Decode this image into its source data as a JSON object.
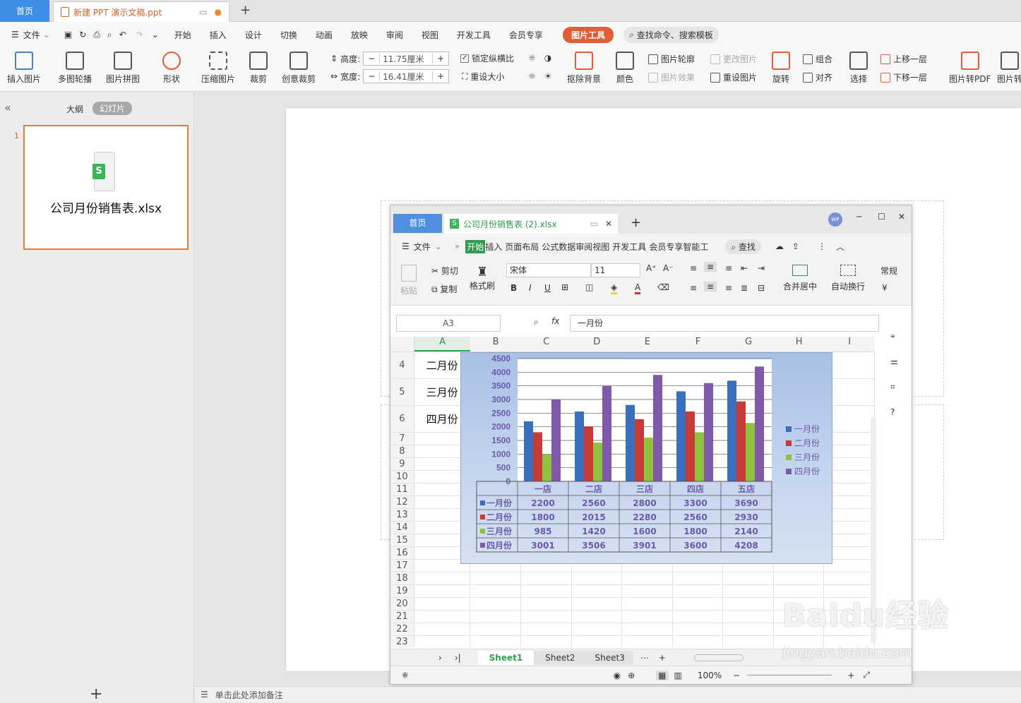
{
  "title_tabs": {
    "home": "首页",
    "doc": "新建 PPT 演示文稿.ppt",
    "new_tab": "+"
  },
  "menu": {
    "file": "文件",
    "items": [
      "开始",
      "插入",
      "设计",
      "切换",
      "动画",
      "放映",
      "审阅",
      "视图",
      "开发工具",
      "会员专享"
    ],
    "active": "图片工具",
    "search": "查找命令、搜索模板"
  },
  "ribbon": {
    "insert_picture": "插入图片",
    "multi_carousel": "多图轮播",
    "picture_collage": "图片拼图",
    "shape": "形状",
    "compress": "压缩图片",
    "crop": "裁剪",
    "creative_crop": "创意裁剪",
    "height_label": "高度:",
    "height_value": "11.75厘米",
    "width_label": "宽度:",
    "width_value": "16.41厘米",
    "lock_ratio": "锁定纵横比",
    "reset_size": "重设大小",
    "remove_bg": "抠除背景",
    "color": "颜色",
    "outline": "图片轮廓",
    "effect": "图片效果",
    "change_pic": "更改图片",
    "reset_pic": "重设图片",
    "rotate": "旋转",
    "group": "组合",
    "align": "对齐",
    "select": "选择",
    "bring_forward": "上移一层",
    "send_backward": "下移一层",
    "to_pdf": "图片转PDF",
    "to_text": "图片转"
  },
  "left_panel": {
    "tab_outline": "大纲",
    "tab_slides": "幻灯片",
    "slide_number": "1",
    "slide_caption": "公司月份销售表.xlsx",
    "add": "+"
  },
  "notes": "单击此处添加备注",
  "excel": {
    "tab_home": "首页",
    "tab_file": "公司月份销售表 (2).xlsx",
    "wps_badge": "WP",
    "menu": [
      "文件",
      "开始",
      "插入",
      "页面布局",
      "公式",
      "数据",
      "审阅",
      "视图",
      "开发工具",
      "会员专享",
      "智能工"
    ],
    "search": "查找",
    "paste": "粘贴",
    "cut": "剪切",
    "copy": "复制",
    "format_painter": "格式刷",
    "font": "宋体",
    "font_size": "11",
    "merge": "合并居中",
    "wrap": "自动换行",
    "number_format": "常规",
    "cell_ref": "A3",
    "fx": "fx",
    "formula": "一月份",
    "columns": [
      "A",
      "B",
      "C",
      "D",
      "E",
      "F",
      "G",
      "H",
      "I"
    ],
    "rows": [
      {
        "n": "4",
        "a": "二月份"
      },
      {
        "n": "5",
        "a": "三月份"
      },
      {
        "n": "6",
        "a": "四月份"
      },
      {
        "n": "7",
        "a": ""
      },
      {
        "n": "8",
        "a": ""
      },
      {
        "n": "9",
        "a": ""
      },
      {
        "n": "10",
        "a": ""
      },
      {
        "n": "11",
        "a": ""
      },
      {
        "n": "12",
        "a": ""
      },
      {
        "n": "13",
        "a": ""
      },
      {
        "n": "14",
        "a": ""
      },
      {
        "n": "15",
        "a": ""
      },
      {
        "n": "16",
        "a": ""
      },
      {
        "n": "17",
        "a": ""
      },
      {
        "n": "18",
        "a": ""
      },
      {
        "n": "19",
        "a": ""
      },
      {
        "n": "20",
        "a": ""
      },
      {
        "n": "21",
        "a": ""
      },
      {
        "n": "22",
        "a": ""
      },
      {
        "n": "23",
        "a": ""
      }
    ],
    "sheets": [
      "Sheet1",
      "Sheet2",
      "Sheet3"
    ],
    "zoom": "100%"
  },
  "chart_data": {
    "type": "bar",
    "categories": [
      "一店",
      "二店",
      "三店",
      "四店",
      "五店"
    ],
    "series": [
      {
        "name": "一月份",
        "color": "#3a6fc0",
        "values": [
          2200,
          2560,
          2800,
          3300,
          3690
        ]
      },
      {
        "name": "二月份",
        "color": "#c83a36",
        "values": [
          1800,
          2015,
          2280,
          2560,
          2930
        ]
      },
      {
        "name": "三月份",
        "color": "#92c23d",
        "values": [
          985,
          1420,
          1600,
          1800,
          2140
        ]
      },
      {
        "name": "四月份",
        "color": "#7f5aaa",
        "values": [
          3001,
          3506,
          3901,
          3600,
          4208
        ]
      }
    ],
    "yticks": [
      "4500",
      "4000",
      "3500",
      "3000",
      "2500",
      "2000",
      "1500",
      "1000",
      "500",
      "0"
    ],
    "ylim": [
      0,
      4500
    ],
    "legend_position": "right",
    "grid": true
  },
  "watermark": {
    "brand": "Baidu经验",
    "url": "jingyan.baidu.com"
  }
}
